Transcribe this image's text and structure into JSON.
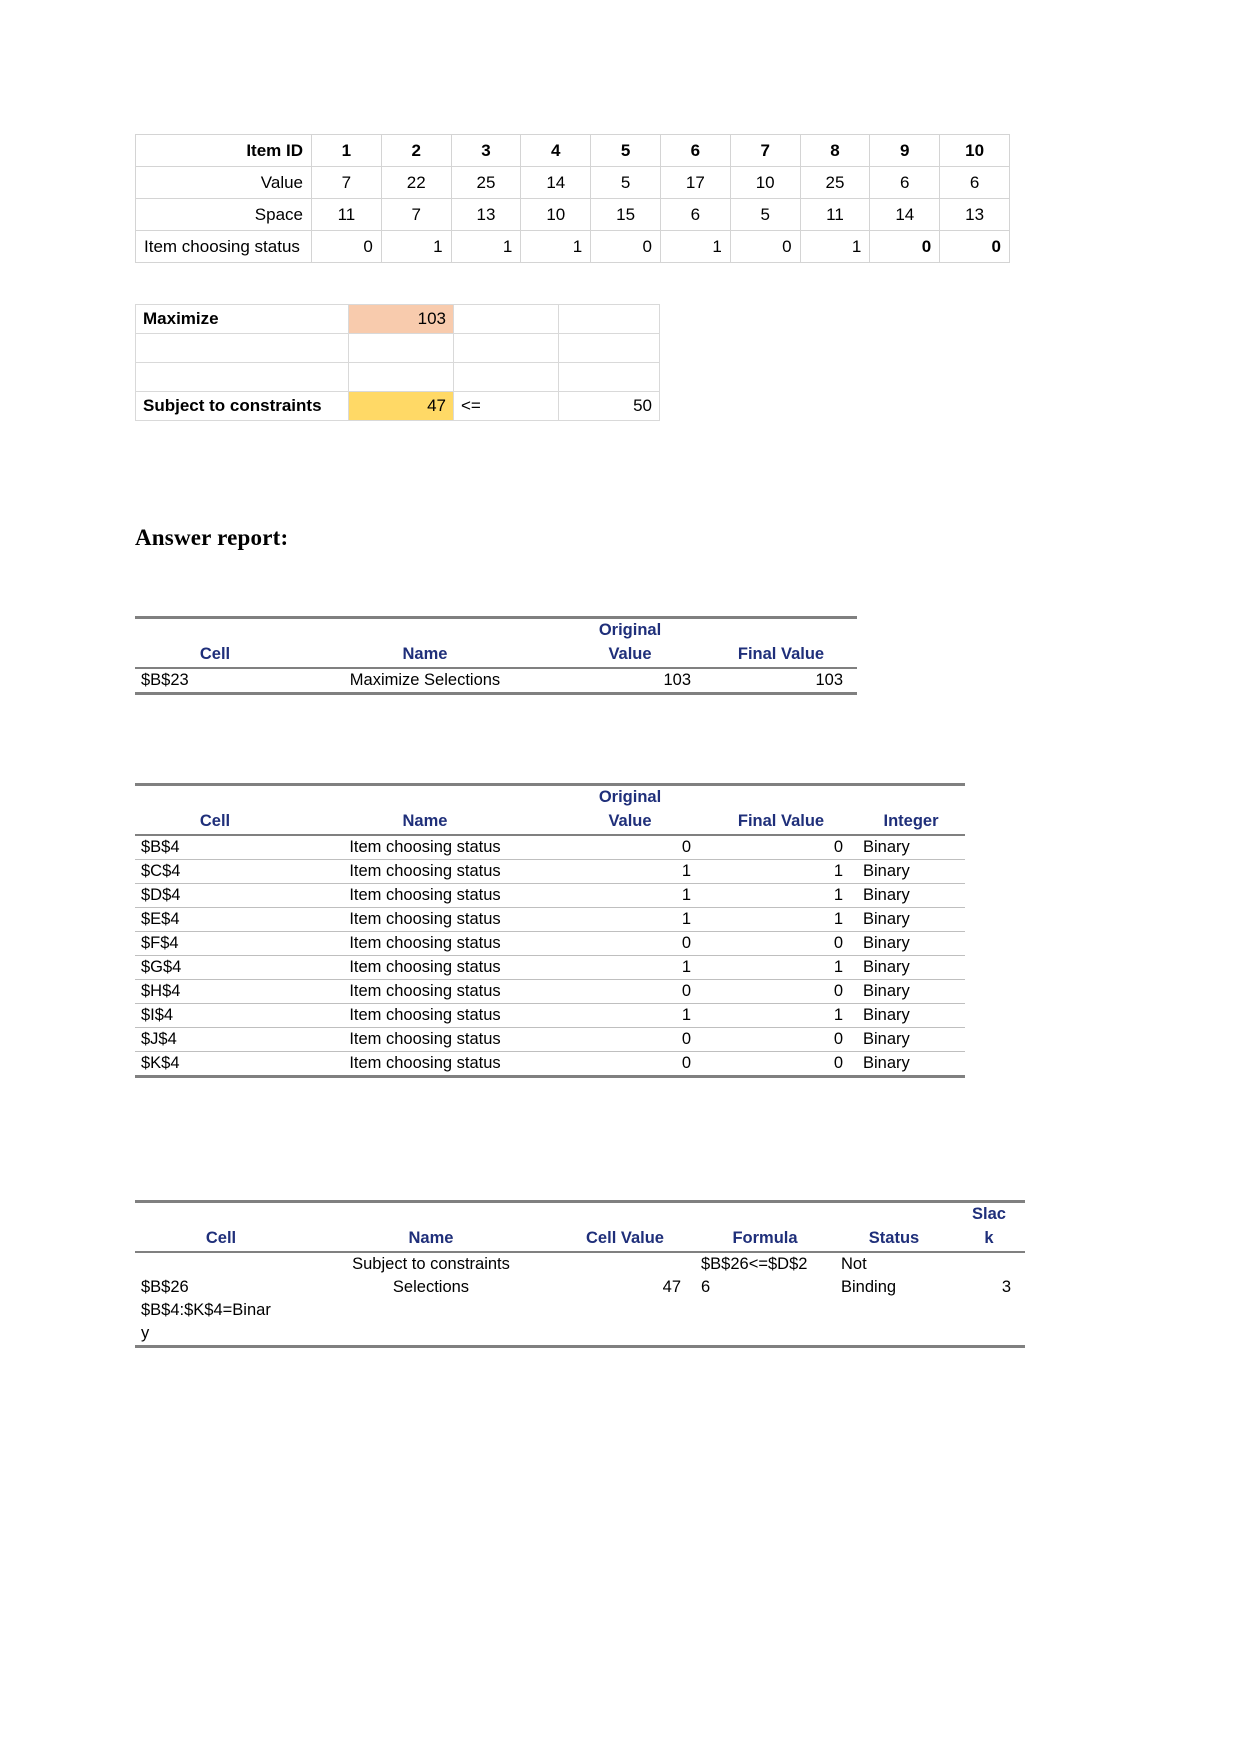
{
  "data_table": {
    "rows": [
      {
        "label": "Item ID",
        "bold": true,
        "align": "center",
        "values": [
          "1",
          "2",
          "3",
          "4",
          "5",
          "6",
          "7",
          "8",
          "9",
          "10"
        ]
      },
      {
        "label": "Value",
        "bold": false,
        "align": "center",
        "values": [
          "7",
          "22",
          "25",
          "14",
          "5",
          "17",
          "10",
          "25",
          "6",
          "6"
        ]
      },
      {
        "label": "Space",
        "bold": false,
        "align": "center",
        "values": [
          "11",
          "7",
          "13",
          "10",
          "15",
          "6",
          "5",
          "11",
          "14",
          "13"
        ]
      },
      {
        "label": "Item choosing status",
        "bold": false,
        "align": "right",
        "values": [
          "0",
          "1",
          "1",
          "1",
          "0",
          "1",
          "0",
          "1",
          "0",
          "0"
        ]
      }
    ]
  },
  "model": {
    "maximize_label": "Maximize",
    "maximize_value": "103",
    "constraint_label": "Subject to constraints",
    "constraint_value": "47",
    "constraint_operator": "<=",
    "constraint_rhs": "50",
    "colors": {
      "objective_fill": "#F8CBAD",
      "constraint_fill": "#FFD966",
      "header_text": "#1F2F7A"
    }
  },
  "section_heading": "Answer report:",
  "report_objective": {
    "headers": [
      "Cell",
      "Name",
      "Original\nValue",
      "Final Value"
    ],
    "headers_flat": {
      "cell": "Cell",
      "name": "Name",
      "original_value_l1": "Original",
      "original_value_l2": "Value",
      "final_value": "Final Value"
    },
    "rows": [
      {
        "cell": "$B$23",
        "name": "Maximize  Selections",
        "original_value": "103",
        "final_value": "103"
      }
    ]
  },
  "report_variables": {
    "headers_flat": {
      "cell": "Cell",
      "name": "Name",
      "original_value_l1": "Original",
      "original_value_l2": "Value",
      "final_value": "Final Value",
      "integer": "Integer"
    },
    "rows": [
      {
        "cell": "$B$4",
        "name": "Item choosing status",
        "original_value": "0",
        "final_value": "0",
        "integer": "Binary"
      },
      {
        "cell": "$C$4",
        "name": "Item choosing status",
        "original_value": "1",
        "final_value": "1",
        "integer": "Binary"
      },
      {
        "cell": "$D$4",
        "name": "Item choosing status",
        "original_value": "1",
        "final_value": "1",
        "integer": "Binary"
      },
      {
        "cell": "$E$4",
        "name": "Item choosing status",
        "original_value": "1",
        "final_value": "1",
        "integer": "Binary"
      },
      {
        "cell": "$F$4",
        "name": "Item choosing status",
        "original_value": "0",
        "final_value": "0",
        "integer": "Binary"
      },
      {
        "cell": "$G$4",
        "name": "Item choosing status",
        "original_value": "1",
        "final_value": "1",
        "integer": "Binary"
      },
      {
        "cell": "$H$4",
        "name": "Item choosing status",
        "original_value": "0",
        "final_value": "0",
        "integer": "Binary"
      },
      {
        "cell": "$I$4",
        "name": "Item choosing status",
        "original_value": "1",
        "final_value": "1",
        "integer": "Binary"
      },
      {
        "cell": "$J$4",
        "name": "Item choosing status",
        "original_value": "0",
        "final_value": "0",
        "integer": "Binary"
      },
      {
        "cell": "$K$4",
        "name": "Item choosing status",
        "original_value": "0",
        "final_value": "0",
        "integer": "Binary"
      }
    ]
  },
  "report_constraints": {
    "headers_flat": {
      "cell": "Cell",
      "name": "Name",
      "cell_value": "Cell Value",
      "formula": "Formula",
      "status": "Status",
      "slack_l1": "Slac",
      "slack_l2": "k"
    },
    "rows": [
      {
        "cell": "",
        "name": "Subject to constraints",
        "cell_value": "",
        "formula": "$B$26<=$D$2",
        "status": "Not",
        "slack": ""
      },
      {
        "cell": "$B$26",
        "name": "Selections",
        "cell_value": "47",
        "formula": "6",
        "status": "Binding",
        "slack": "3"
      },
      {
        "cell": "$B$4:$K$4=Binar",
        "name": "",
        "cell_value": "",
        "formula": "",
        "status": "",
        "slack": ""
      },
      {
        "cell": "y",
        "name": "",
        "cell_value": "",
        "formula": "",
        "status": "",
        "slack": ""
      }
    ]
  }
}
